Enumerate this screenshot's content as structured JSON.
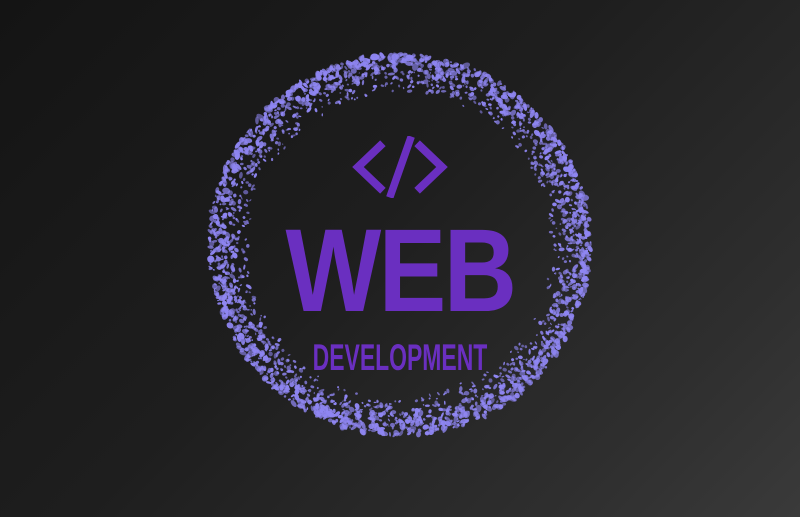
{
  "logo": {
    "icon": "code-brackets-icon",
    "title": "WEB",
    "subtitle": "DEVELOPMENT"
  },
  "colors": {
    "background_dark": "#141414",
    "background_light": "#3a3a3a",
    "ring_dots": "#8f86f2",
    "text_primary": "#6a2fc0"
  }
}
